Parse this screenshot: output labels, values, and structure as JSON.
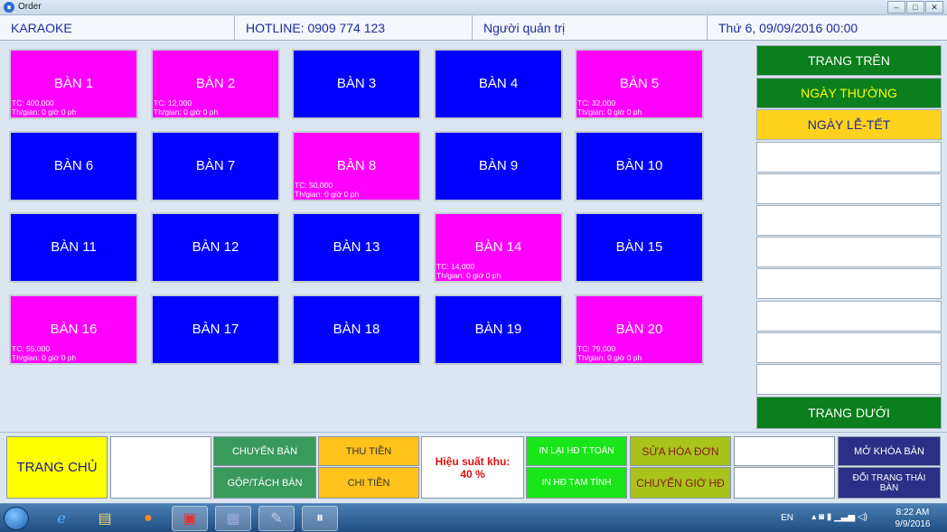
{
  "window": {
    "title": "Order",
    "minimize": "–",
    "maximize": "□",
    "close": "✕"
  },
  "header": {
    "app_name": "KARAOKE",
    "hotline": "HOTLINE: 0909 774 123",
    "user": "Người quản trị",
    "datetime": "Thứ 6, 09/09/2016  00:00"
  },
  "tables": [
    {
      "name": "BÀN 1",
      "status": "occupied",
      "total": "TC: 400,000",
      "time": "Th/gian: 0 giờ 0 ph"
    },
    {
      "name": "BÀN 2",
      "status": "occupied",
      "total": "TC: 12,000",
      "time": "Th/gian: 0 giờ 0 ph"
    },
    {
      "name": "BÀN 3",
      "status": "empty",
      "total": "",
      "time": ""
    },
    {
      "name": "BÀN 4",
      "status": "empty",
      "total": "",
      "time": ""
    },
    {
      "name": "BÀN 5",
      "status": "occupied",
      "total": "TC: 32,000",
      "time": "Th/gian: 0 giờ 0 ph"
    },
    {
      "name": "BÀN 6",
      "status": "empty",
      "total": "",
      "time": ""
    },
    {
      "name": "BÀN 7",
      "status": "empty",
      "total": "",
      "time": ""
    },
    {
      "name": "BÀN 8",
      "status": "occupied",
      "total": "TC: 50,000",
      "time": "Th/gian: 0 giờ 0 ph"
    },
    {
      "name": "BÀN 9",
      "status": "empty",
      "total": "",
      "time": ""
    },
    {
      "name": "BÀN 10",
      "status": "empty",
      "total": "",
      "time": ""
    },
    {
      "name": "BÀN 11",
      "status": "empty",
      "total": "",
      "time": ""
    },
    {
      "name": "BÀN 12",
      "status": "empty",
      "total": "",
      "time": ""
    },
    {
      "name": "BÀN 13",
      "status": "empty",
      "total": "",
      "time": ""
    },
    {
      "name": "BÀN 14",
      "status": "occupied",
      "total": "TC: 14,000",
      "time": "Th/gian: 0 giờ 0 ph"
    },
    {
      "name": "BÀN 15",
      "status": "empty",
      "total": "",
      "time": ""
    },
    {
      "name": "BÀN 16",
      "status": "occupied",
      "total": "TC: 55,000",
      "time": "Th/gian: 0 giờ 0 ph"
    },
    {
      "name": "BÀN 17",
      "status": "empty",
      "total": "",
      "time": ""
    },
    {
      "name": "BÀN 18",
      "status": "empty",
      "total": "",
      "time": ""
    },
    {
      "name": "BÀN 19",
      "status": "empty",
      "total": "",
      "time": ""
    },
    {
      "name": "BÀN 20",
      "status": "occupied",
      "total": "TC: 79,000",
      "time": "Th/gian: 0 giờ 0 ph"
    }
  ],
  "colors": {
    "empty": "#0000ff",
    "occupied": "#ff00ff"
  },
  "right_panel": {
    "page_up": "TRANG TRÊN",
    "weekday": "NGÀY THƯỜNG",
    "holiday": "NGÀY LỄ-TẾT",
    "page_down": "TRANG DƯỚI"
  },
  "bottom": {
    "home": "TRANG CHỦ",
    "move_table": "CHUYỂN BÀN",
    "merge_split": "GỘP/TÁCH  BÀN",
    "income": "THU TIỀN",
    "expense": "CHI TIỀN",
    "perf_label": "Hiệu suất khu:",
    "perf_value": "40 %",
    "reprint": "IN LẠI HĐ T.TOÁN",
    "print_temp": "IN HĐ TẠM TÍNH",
    "edit_order": "SỬA HÓA ĐƠN",
    "move_time": "CHUYỂN GIỜ HĐ",
    "unlock": "MỞ KHÓA BÀN",
    "change_status": "ĐỔI TRẠNG THÁI BÀN"
  },
  "taskbar": {
    "lang": "EN",
    "time": "8:22 AM",
    "date": "9/9/2016"
  }
}
